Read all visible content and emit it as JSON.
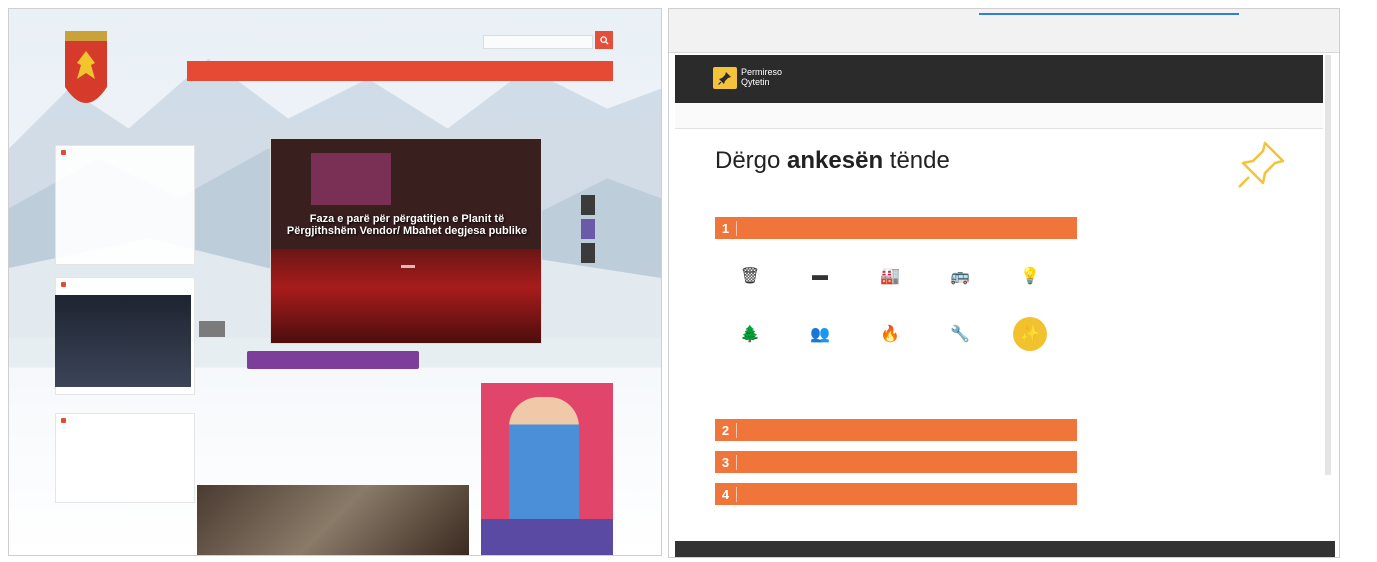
{
  "left": {
    "search_placeholder": "",
    "nav_items": [
      "",
      "",
      "",
      "",
      "",
      "",
      "",
      ""
    ],
    "box1": {
      "heading": "",
      "items": [
        "",
        "",
        "",
        ""
      ],
      "more": ""
    },
    "box2": {
      "heading": ""
    },
    "box3": {
      "heading": "",
      "items": [
        "",
        "",
        ""
      ],
      "more": ""
    },
    "hero_title": "Faza e parë për përgatitjen e Planit të Përgjithshëm Vendor/ Mbahet degjesa publike",
    "purple_button": "",
    "blue_link": "",
    "news_heading": "",
    "news_cols": [
      "",
      "",
      "",
      ""
    ],
    "projects_heading": "",
    "promo_text": ""
  },
  "right": {
    "url": "",
    "logo_text_line1": "Permireso",
    "logo_text_line2": "Qytetin",
    "store_links": "",
    "subnav_items": [
      "",
      "",
      "",
      "",
      "",
      ""
    ],
    "subnav_right": "",
    "title_pre": "Dërgo ",
    "title_bold": "ankesën",
    "title_post": " tënde",
    "steps": [
      {
        "num": "1",
        "label": ""
      },
      {
        "num": "2",
        "label": ""
      },
      {
        "num": "3",
        "label": ""
      },
      {
        "num": "4",
        "label": ""
      }
    ],
    "categories": [
      {
        "icon": "trash-icon",
        "label": ""
      },
      {
        "icon": "building-icon",
        "label": ""
      },
      {
        "icon": "factory-icon",
        "label": ""
      },
      {
        "icon": "bus-icon",
        "label": ""
      },
      {
        "icon": "streetlight-icon",
        "label": ""
      },
      {
        "icon": "tree-icon",
        "label": ""
      },
      {
        "icon": "people-icon",
        "label": ""
      },
      {
        "icon": "fire-icon",
        "label": ""
      },
      {
        "icon": "tools-icon",
        "label": ""
      },
      {
        "icon": "magic-wand-icon",
        "label": ""
      }
    ],
    "more_link": "",
    "accent_color": "#f0753a",
    "active_category_color": "#f2c12e"
  }
}
